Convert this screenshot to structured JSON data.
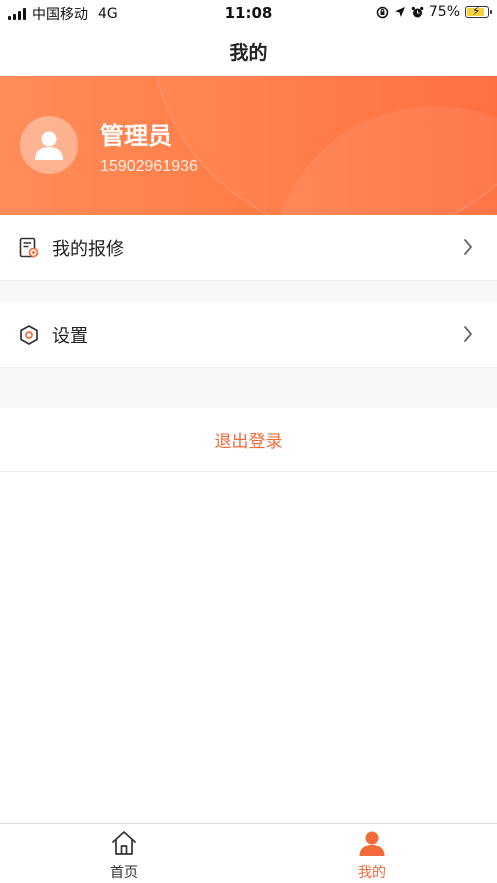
{
  "status_bar": {
    "carrier": "中国移动",
    "network": "4G",
    "time": "11:08",
    "battery": "75%"
  },
  "header": {
    "title": "我的"
  },
  "profile": {
    "name": "管理员",
    "phone": "15902961936"
  },
  "menu": [
    {
      "label": "我的报修",
      "icon": "repair-doc-icon"
    },
    {
      "label": "设置",
      "icon": "settings-hex-icon"
    }
  ],
  "logout_label": "退出登录",
  "tabs": [
    {
      "label": "首页",
      "icon": "home-icon",
      "active": false
    },
    {
      "label": "我的",
      "icon": "person-icon",
      "active": true
    }
  ],
  "colors": {
    "accent": "#f26b3a",
    "banner_start": "#ff8d5a",
    "banner_end": "#ff6a3a"
  }
}
